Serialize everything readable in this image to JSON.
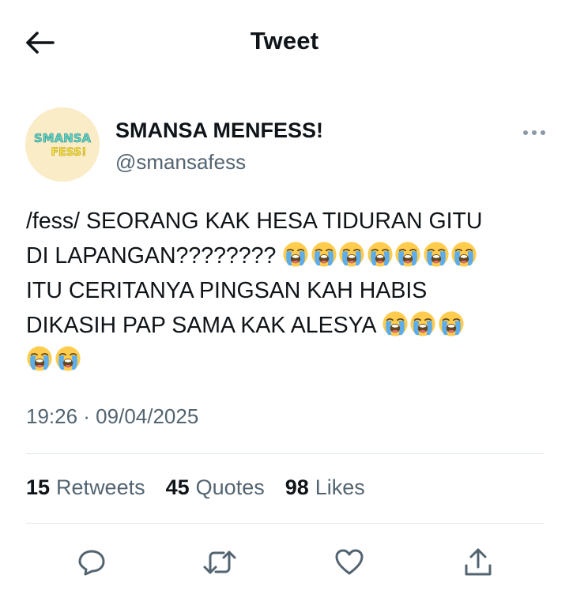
{
  "header": {
    "title": "Tweet",
    "back_icon": "arrow-left-icon"
  },
  "author": {
    "display_name": "SMANSA MENFESS!",
    "handle": "@smansafess",
    "avatar_text_top": "SMANSA",
    "avatar_text_bottom": "FESS!",
    "avatar_bg": "#fbecc8"
  },
  "tweet": {
    "lines": [
      {
        "text": "/fess/ SEORANG KAK HESA TIDURAN GITU",
        "emoji_count": 0
      },
      {
        "text": "DI LAPANGAN???????? ",
        "emoji_count": 7
      },
      {
        "text": "ITU CERITANYA PINGSAN KAH HABIS",
        "emoji_count": 0
      },
      {
        "text": "DIKASIH PAP SAMA KAK ALESYA ",
        "emoji_count": 3
      },
      {
        "text": "",
        "emoji_count": 2
      }
    ],
    "emoji": "loudly-crying-face",
    "timestamp": "19:26 · 09/04/2025"
  },
  "stats": [
    {
      "count": "15",
      "label": "Retweets"
    },
    {
      "count": "45",
      "label": "Quotes"
    },
    {
      "count": "98",
      "label": "Likes"
    }
  ],
  "actions": [
    {
      "name": "reply-icon"
    },
    {
      "name": "retweet-icon"
    },
    {
      "name": "like-icon"
    },
    {
      "name": "share-icon"
    }
  ],
  "colors": {
    "text_primary": "#0f1419",
    "text_secondary": "#536471",
    "divider": "#e1e8ed"
  }
}
